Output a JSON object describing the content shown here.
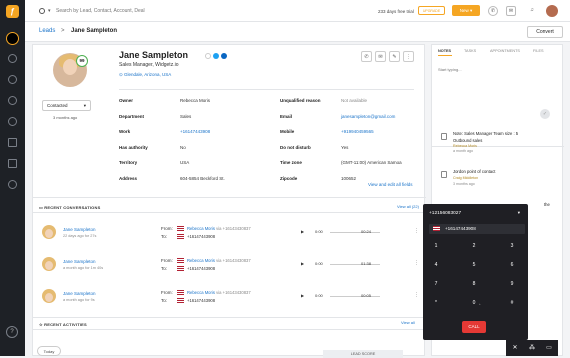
{
  "app": {
    "logo_char": "ƒ",
    "colors": {
      "accent": "#f5a623",
      "link": "#1a73c9",
      "sidebar": "#1e2126",
      "call": "#e53935",
      "score_ring": "#4caf50"
    }
  },
  "topbar": {
    "search_placeholder": "Search by Lead, Contact, Account, Deal",
    "trial_text": "233 days free trial",
    "upgrade_label": "UPGRADE",
    "new_label": "New",
    "icons": [
      "phone-icon",
      "mail-icon",
      "bell-icon"
    ]
  },
  "breadcrumb": {
    "parent": "Leads",
    "separator": ">",
    "current": "Jane Sampleton",
    "convert_label": "Convert"
  },
  "lead": {
    "name": "Jane Sampleton",
    "title": "Sales Manager, Widgetz.io",
    "location": "Glendale, Arizona, USA",
    "score": "99",
    "status": "Contacted",
    "status_time": "3 months ago",
    "fields_left": [
      {
        "label": "Owner",
        "value": "Rebecca Moris",
        "style": "fv"
      },
      {
        "label": "Department",
        "value": "Sales",
        "style": "fv"
      },
      {
        "label": "Work",
        "value": "+16147443908",
        "style": "fv link"
      },
      {
        "label": "Has authority",
        "value": "No",
        "style": "fv"
      },
      {
        "label": "Territory",
        "value": "USA",
        "style": "fv"
      },
      {
        "label": "Address",
        "value": "604-5854 Beckford St.",
        "style": "fv"
      }
    ],
    "fields_right": [
      {
        "label": "Unqualified reason",
        "value": "Not available",
        "style": "fv muted"
      },
      {
        "label": "Email",
        "value": "janesampleton@gmail.com",
        "style": "fv link"
      },
      {
        "label": "Mobile",
        "value": "+919940459565",
        "style": "fv link"
      },
      {
        "label": "Do not disturb",
        "value": "Yes",
        "style": "fv"
      },
      {
        "label": "Time zone",
        "value": "(GMT-11:00) American Samoa",
        "style": "fv"
      },
      {
        "label": "Zipcode",
        "value": "100652",
        "style": "fv"
      }
    ],
    "view_edit": "View and edit all fields"
  },
  "conversations": {
    "title": "RECENT CONVERSATIONS",
    "view_all": "View all (22)",
    "items": [
      {
        "name": "Jane Sampleton",
        "ago": "22 days ago for 27s",
        "from": "Rebecca Moris",
        "from_via": "via +16143430837",
        "to": "+16147443908",
        "start": "0:00",
        "duration": "00:24"
      },
      {
        "name": "Jane Sampleton",
        "ago": "a month ago for 1m 40s",
        "from": "Rebecca Moris",
        "from_via": "via +16143430837",
        "to": "+16147443908",
        "start": "0:00",
        "duration": "01:38"
      },
      {
        "name": "Jane Sampleton",
        "ago": "a month ago for 9s",
        "from": "Rebecca Moris",
        "from_via": "via +16143430837",
        "to": "+16147443908",
        "start": "0:00",
        "duration": "00:05"
      }
    ],
    "from_label": "From:",
    "to_label": "To:"
  },
  "activities": {
    "title": "RECENT ACTIVITIES",
    "view_all": "View all",
    "today": "Today",
    "lead_score_label": "LEAD SCORE"
  },
  "right_panel": {
    "tabs": [
      "NOTES",
      "TASKS",
      "APPOINTMENTS",
      "FILES"
    ],
    "note_placeholder": "Start typing...",
    "items": [
      {
        "text1": "Note: Sales Manager Team size : 5",
        "text2": "Outbound sales",
        "by": "Rebecca Moris",
        "ago": "a month ago"
      },
      {
        "text1": "Jordon point of contact",
        "text2": "",
        "by": "Craig Middleton",
        "ago": "3 months ago"
      }
    ],
    "partial_text": "the"
  },
  "dialer": {
    "number": "+12156083027",
    "from_number": "+16147443908",
    "keys": [
      {
        "k": "1",
        "s": ""
      },
      {
        "k": "2",
        "s": ""
      },
      {
        "k": "3",
        "s": ""
      },
      {
        "k": "4",
        "s": ""
      },
      {
        "k": "5",
        "s": ""
      },
      {
        "k": "6",
        "s": ""
      },
      {
        "k": "7",
        "s": ""
      },
      {
        "k": "8",
        "s": ""
      },
      {
        "k": "9",
        "s": ""
      },
      {
        "k": "*",
        "s": ""
      },
      {
        "k": "0",
        "s": "+"
      },
      {
        "k": "#",
        "s": ""
      }
    ],
    "call_label": "CALL"
  }
}
